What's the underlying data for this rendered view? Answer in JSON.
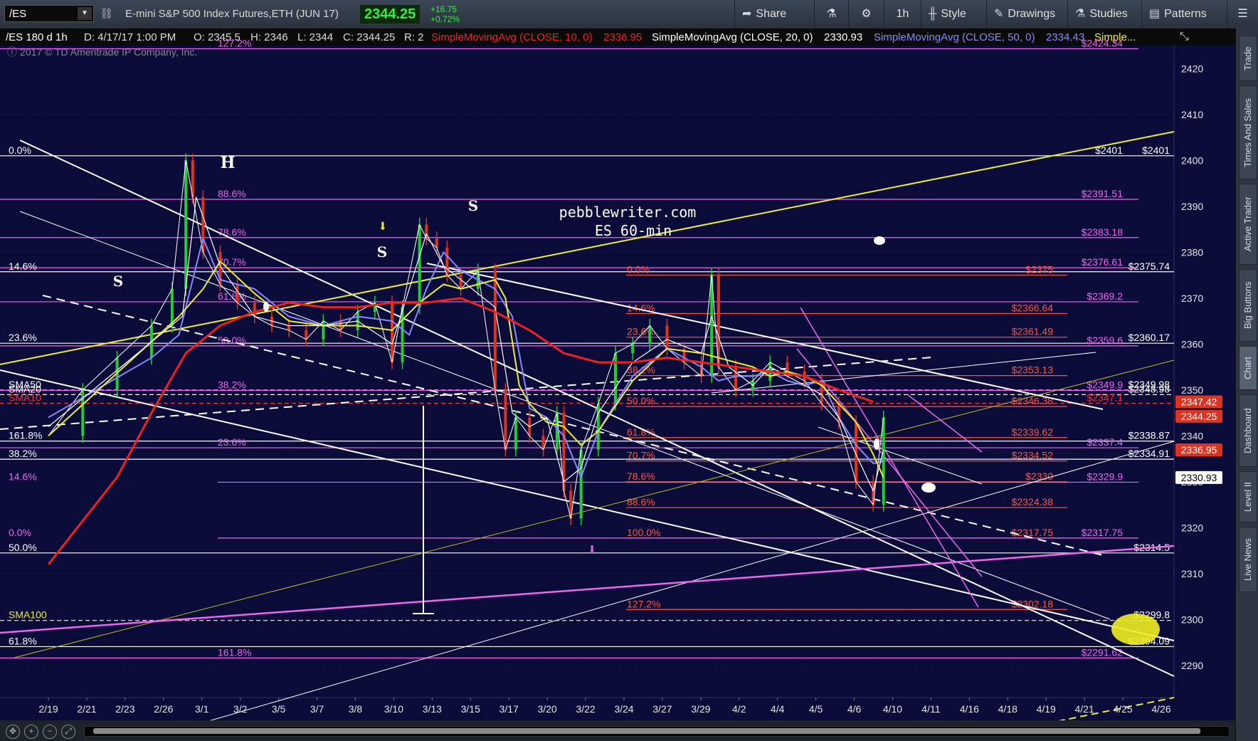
{
  "toolbar": {
    "symbol": "/ES",
    "instrument": "E-mini S&P 500 Index Futures,ETH (JUN 17)",
    "last": "2344.25",
    "change": "+16.75",
    "change_pct": "+0.72%",
    "share": "Share",
    "timeframe": "1h",
    "style": "Style",
    "drawings": "Drawings",
    "studies": "Studies",
    "patterns": "Patterns"
  },
  "colors": {
    "background": "#0b0b3a",
    "sma10": "#ee2222",
    "sma20": "#ffffff",
    "sma50": "#8888ff",
    "sma100": "#eeee33",
    "fib": "#ee66ee",
    "fib_red": "#ff5544"
  },
  "header": {
    "symbol_info": "/ES 180 d 1h",
    "datetime": "D: 4/17/17 1:00 PM",
    "open": "O: 2345.5",
    "high": "H: 2346",
    "low": "L: 2344",
    "close": "C: 2344.25",
    "range": "R: 2",
    "sma10_label": "SimpleMovingAvg (CLOSE, 10, 0)",
    "sma10_value": "2336.95",
    "sma20_label": "SimpleMovingAvg (CLOSE, 20, 0)",
    "sma20_value": "2330.93",
    "sma50_label": "SimpleMovingAvg (CLOSE, 50, 0)",
    "sma50_value": "2334.43",
    "more_label": "Simple...",
    "copyright": "2017 © TD Ameritrade IP Company, Inc."
  },
  "right_tabs": [
    "Trade",
    "Times And Sales",
    "Active Trader",
    "Big Buttons",
    "Chart",
    "Dashboard",
    "Level II",
    "Live News"
  ],
  "chart_data": {
    "type": "line",
    "ylim": [
      2283,
      2425
    ],
    "y_ticks": [
      2290,
      2300,
      2310,
      2320,
      2330,
      2340,
      2350,
      2360,
      2370,
      2380,
      2390,
      2400,
      2410,
      2420
    ],
    "x_ticks": [
      "2/19",
      "2/21",
      "2/23",
      "2/26",
      "3/1",
      "3/2",
      "3/5",
      "3/7",
      "3/8",
      "3/10",
      "3/13",
      "3/15",
      "3/17",
      "3/20",
      "3/22",
      "3/24",
      "3/27",
      "3/29",
      "4/2",
      "4/4",
      "4/5",
      "4/6",
      "4/10",
      "4/11",
      "4/16",
      "4/18",
      "4/19",
      "4/21",
      "4/25",
      "4/26"
    ],
    "price_path": {
      "x_index": [
        0,
        1,
        2,
        3,
        3.6,
        4,
        4.2,
        4.5,
        5,
        5.5,
        6,
        6.5,
        7,
        7.5,
        8,
        8.5,
        9,
        9.5,
        10,
        10.3,
        10.8,
        11,
        11.3,
        11.6,
        12,
        12.5,
        13,
        13.3,
        13.6,
        14,
        14.4,
        14.8,
        15,
        15.2,
        15.5,
        16,
        16.5,
        17,
        17.5,
        18,
        18.5,
        19,
        19.3,
        19.5,
        20,
        20.5,
        21,
        21.5,
        22,
        22.5,
        23,
        23.5,
        24,
        24.3
      ],
      "close": [
        2340,
        2350,
        2357,
        2364,
        2372,
        2400,
        2392,
        2380,
        2373,
        2369,
        2366,
        2364,
        2363,
        2361,
        2365,
        2363,
        2367,
        2369,
        2356,
        2368,
        2386,
        2383,
        2381,
        2375,
        2372,
        2376,
        2350,
        2337,
        2344,
        2340,
        2337,
        2345,
        2328,
        2322,
        2337,
        2347,
        2358,
        2360,
        2364,
        2359,
        2356,
        2353,
        2375,
        2355,
        2350,
        2352,
        2356,
        2354,
        2352,
        2347,
        2343,
        2330,
        2325,
        2344
      ]
    },
    "sma10": {
      "x_index": [
        0,
        3.9,
        4.3,
        5,
        6,
        7,
        8,
        9,
        10,
        11,
        11.5,
        12,
        13,
        13.5,
        14,
        14.5,
        15,
        15.5,
        16,
        17,
        18,
        19,
        19.3,
        19.8,
        20.5,
        21,
        21.5,
        22,
        22.5,
        23,
        23.5,
        24,
        24.3
      ],
      "values": [
        2342,
        2366,
        2392,
        2377,
        2366,
        2364,
        2364,
        2365,
        2360,
        2384,
        2377,
        2374,
        2368,
        2345,
        2342,
        2344,
        2330,
        2333,
        2345,
        2356,
        2361,
        2358,
        2366,
        2355,
        2351,
        2355,
        2353,
        2351,
        2349,
        2344,
        2336,
        2328,
        2336.95
      ]
    },
    "sma20": {
      "x_index": [
        0,
        3.8,
        4.5,
        5,
        6,
        7,
        8,
        9,
        10,
        10.8,
        11.5,
        12,
        13,
        13.3,
        13.7,
        14,
        14.5,
        15,
        15.5,
        16,
        17,
        18,
        19,
        19.5,
        20,
        20.5,
        21,
        21.5,
        22,
        22.5,
        23,
        23.5,
        24,
        24.3
      ],
      "values": [
        2340,
        2366,
        2372,
        2378,
        2371,
        2365,
        2364,
        2364,
        2363,
        2369,
        2373,
        2372,
        2374,
        2370,
        2351,
        2347,
        2343,
        2342,
        2338,
        2341,
        2352,
        2359,
        2358,
        2357,
        2356,
        2355,
        2353,
        2354,
        2353,
        2351,
        2347,
        2343,
        2336,
        2330.93
      ]
    },
    "sma50": {
      "x_index": [
        0,
        3,
        3.8,
        4.5,
        5,
        6,
        7,
        8,
        9,
        10,
        10.5,
        11,
        11.5,
        12,
        13,
        13.5,
        14,
        14.5,
        15,
        15.5,
        16,
        17,
        18,
        19,
        19.5,
        20,
        20.5,
        21,
        21.5,
        22,
        22.5,
        23,
        23.5,
        24,
        24.3
      ],
      "values": [
        2344,
        2357,
        2362,
        2383,
        2374,
        2372,
        2366,
        2364,
        2366,
        2365,
        2362,
        2372,
        2380,
        2376,
        2372,
        2366,
        2346,
        2344,
        2340,
        2331,
        2341,
        2353,
        2359,
        2355,
        2352,
        2353,
        2353,
        2354,
        2352,
        2351,
        2352,
        2344,
        2338,
        2334,
        2334.43
      ]
    },
    "sma100": {
      "x_index": [
        0,
        2,
        3,
        4,
        5,
        6,
        7,
        8,
        9,
        10,
        11,
        12,
        13,
        14,
        15,
        16,
        17,
        18,
        19,
        20,
        21,
        22,
        23,
        24
      ],
      "values": [
        2312,
        2331,
        2345,
        2358,
        2364,
        2367,
        2369,
        2368,
        2368,
        2369,
        2369,
        2370,
        2367,
        2363,
        2358,
        2356,
        2356,
        2357,
        2356,
        2355,
        2354,
        2353,
        2350,
        2347.42
      ]
    },
    "hlines": [
      {
        "y": 2401,
        "style": "solid",
        "color": "#ffffff",
        "left": "0.0%",
        "right": "$2401",
        "right2": "$2401"
      },
      {
        "y": 2391.51,
        "style": "solid",
        "color": "#ee66ee",
        "left": "88.6%",
        "right": "$2391.51"
      },
      {
        "y": 2383.18,
        "style": "solid",
        "color": "#ee66ee",
        "left": "78.6%",
        "right": "$2383.18"
      },
      {
        "y": 2376.61,
        "style": "solid",
        "color": "#ee66ee",
        "left": "70.7%",
        "right": "$2376.61"
      },
      {
        "y": 2375.74,
        "style": "solid",
        "color": "#ffffff",
        "left": "14.6%",
        "right2": "$2375.74"
      },
      {
        "y": 2375,
        "style": "solid",
        "color": "#ff5544",
        "left": "0.0%",
        "right": "$2375"
      },
      {
        "y": 2369.2,
        "style": "solid",
        "color": "#ee66ee",
        "left": "61.8%",
        "right": "$2369.2"
      },
      {
        "y": 2366.64,
        "style": "solid",
        "color": "#ff5544",
        "left": "14.6%",
        "right": "$2366.64"
      },
      {
        "y": 2361.49,
        "style": "solid",
        "color": "#ff5544",
        "left": "23.6%",
        "right": "$2361.49"
      },
      {
        "y": 2360.17,
        "style": "solid",
        "color": "#ffffff",
        "left": "23.6%",
        "right2": "$2360.17"
      },
      {
        "y": 2359.6,
        "style": "solid",
        "color": "#ee66ee",
        "left": "50.0%",
        "right": "$2359.6"
      },
      {
        "y": 2353.13,
        "style": "solid",
        "color": "#ff5544",
        "left": "38.2%",
        "right": "$2353.13"
      },
      {
        "y": 2349.98,
        "style": "dashed",
        "color": "#ffffff",
        "left": "SMA50",
        "right2": "$2349.98"
      },
      {
        "y": 2349.9,
        "style": "solid",
        "color": "#ee66ee",
        "left": "38.2%",
        "right": "$2349.9"
      },
      {
        "y": 2348.98,
        "style": "dashed",
        "color": "#ffffff",
        "left": "SMA20",
        "right2": "$2348.98"
      },
      {
        "y": 2346.38,
        "style": "solid",
        "color": "#ff5544",
        "left": "50.0%",
        "right": "$2346.38"
      },
      {
        "y": 2347.1,
        "style": "dashed",
        "color": "#ff3333",
        "left": "SMA10",
        "right": "$2347.1"
      },
      {
        "y": 2339.62,
        "style": "solid",
        "color": "#ff5544",
        "left": "61.8%",
        "right": "$2339.62"
      },
      {
        "y": 2338.87,
        "style": "solid",
        "color": "#ffffff",
        "left": "161.8%",
        "right2": "$2338.87"
      },
      {
        "y": 2337.4,
        "style": "solid",
        "color": "#ee66ee",
        "left": "23.6%",
        "right": "$2337.4"
      },
      {
        "y": 2334.91,
        "style": "solid",
        "color": "#ffffff",
        "left": "38.2%",
        "right2": "$2334.91"
      },
      {
        "y": 2334.52,
        "style": "solid",
        "color": "#ff5544",
        "left": "70.7%",
        "right": "$2334.52"
      },
      {
        "y": 2330,
        "style": "solid",
        "color": "#ff5544",
        "left": "78.6%",
        "right": "$2330"
      },
      {
        "y": 2329.9,
        "style": "solid",
        "color": "#ee66ee",
        "left": "14.6%",
        "right": "$2329.9"
      },
      {
        "y": 2324.38,
        "style": "solid",
        "color": "#ff5544",
        "left": "88.6%",
        "right": "$2324.38"
      },
      {
        "y": 2317.75,
        "style": "solid",
        "color": "#ff5544",
        "left": "100.0%",
        "right": "$2317.75"
      },
      {
        "y": 2317.75,
        "style": "solid",
        "color": "#ee66ee",
        "left": "0.0%",
        "right": "$2317.75"
      },
      {
        "y": 2314.5,
        "style": "solid",
        "color": "#ffffff",
        "left": "50.0%",
        "right2": "$2314.5"
      },
      {
        "y": 2302.18,
        "style": "solid",
        "color": "#ff5544",
        "left": "127.2%",
        "right": "$2302.18"
      },
      {
        "y": 2299.8,
        "style": "dashed",
        "color": "#eeee33",
        "left": "SMA100",
        "right2": "$2299.8"
      },
      {
        "y": 2294.09,
        "style": "solid",
        "color": "#ffffff",
        "left": "61.8%",
        "right2": "$2294.09"
      },
      {
        "y": 2291.62,
        "style": "solid",
        "color": "#ee66ee",
        "left": "161.8%",
        "right": "$2291.62"
      },
      {
        "y": 2424.3,
        "style": "solid",
        "color": "#ee66ee",
        "left": "127.2%",
        "right": "$2424.34"
      }
    ],
    "price_tags": [
      {
        "value": "2347.42",
        "bg": "#dd3322",
        "fg": "#ffffff"
      },
      {
        "value": "2344.25",
        "bg": "#dd3322",
        "fg": "#ffffff"
      },
      {
        "value": "2336.95",
        "bg": "#dd3322",
        "fg": "#ffffff"
      },
      {
        "value": "2330.93",
        "bg": "#ffffff",
        "fg": "#000000"
      }
    ],
    "annotations": {
      "site": "pebblewriter.com",
      "subtitle": "ES 60-min",
      "head": "H",
      "shoulder_left": "S",
      "shoulder_mid": "S",
      "shoulder_right": "S"
    }
  }
}
